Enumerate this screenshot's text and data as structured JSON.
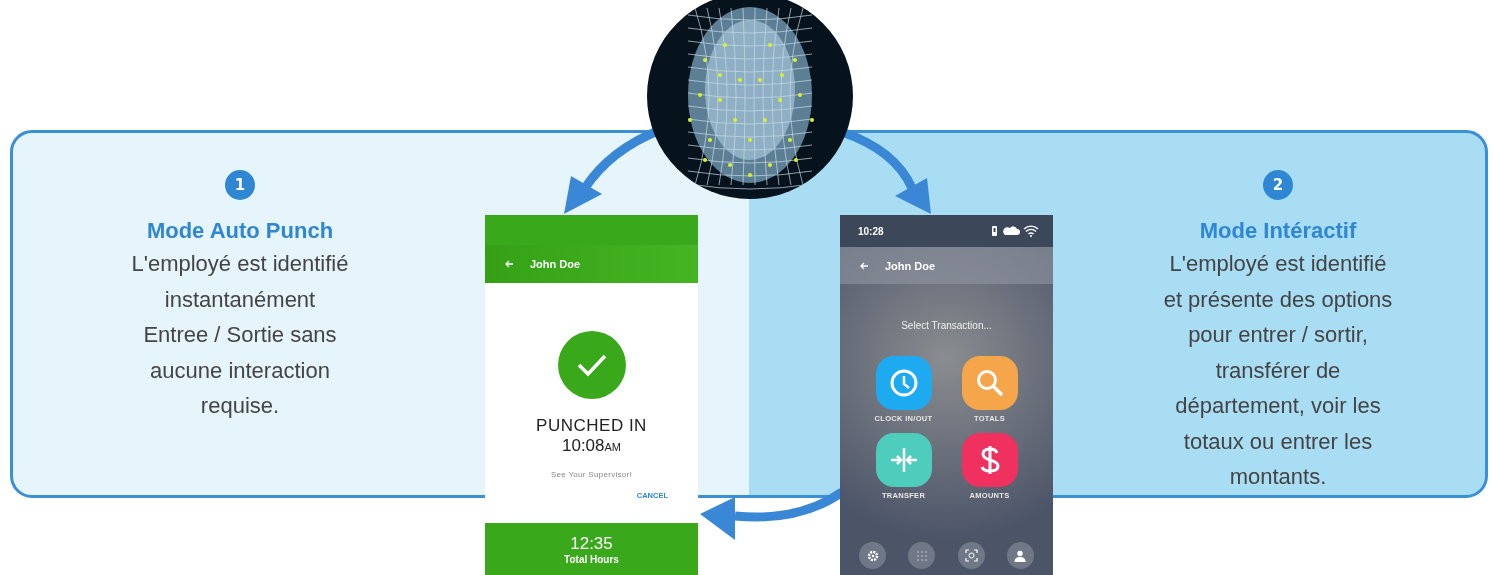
{
  "modes": [
    {
      "number": "1",
      "title": "Mode Auto Punch",
      "description": "L'employé est identifié\ninstantanément\nEntree / Sortie sans\naucune interaction\nrequise."
    },
    {
      "number": "2",
      "title": "Mode Intéractif",
      "description": "L'employé est identifié\net présente des options\npour entrer / sortir,\ntransférer de\ndépartement, voir les\ntotaux ou entrer les\nmontants."
    }
  ],
  "punch_screen": {
    "user": "John Doe",
    "status": "PUNCHED IN",
    "time": "10:08",
    "meridiem": "AM",
    "message": "See Your Supervisor!",
    "cancel": "CANCEL",
    "total": "12:35",
    "total_label": "Total Hours"
  },
  "menu_screen": {
    "clock": "10:28",
    "user": "John Doe",
    "prompt": "Select Transaction...",
    "tiles": [
      {
        "kind": "clock",
        "label": "CLOCK IN/OUT",
        "color": "#1eaaf0"
      },
      {
        "kind": "search",
        "label": "TOTALS",
        "color": "#f5a54a"
      },
      {
        "kind": "transfer",
        "label": "TRANSFER",
        "color": "#4ecdbd"
      },
      {
        "kind": "dollar",
        "label": "AMOUNTS",
        "color": "#f0305e"
      }
    ]
  }
}
